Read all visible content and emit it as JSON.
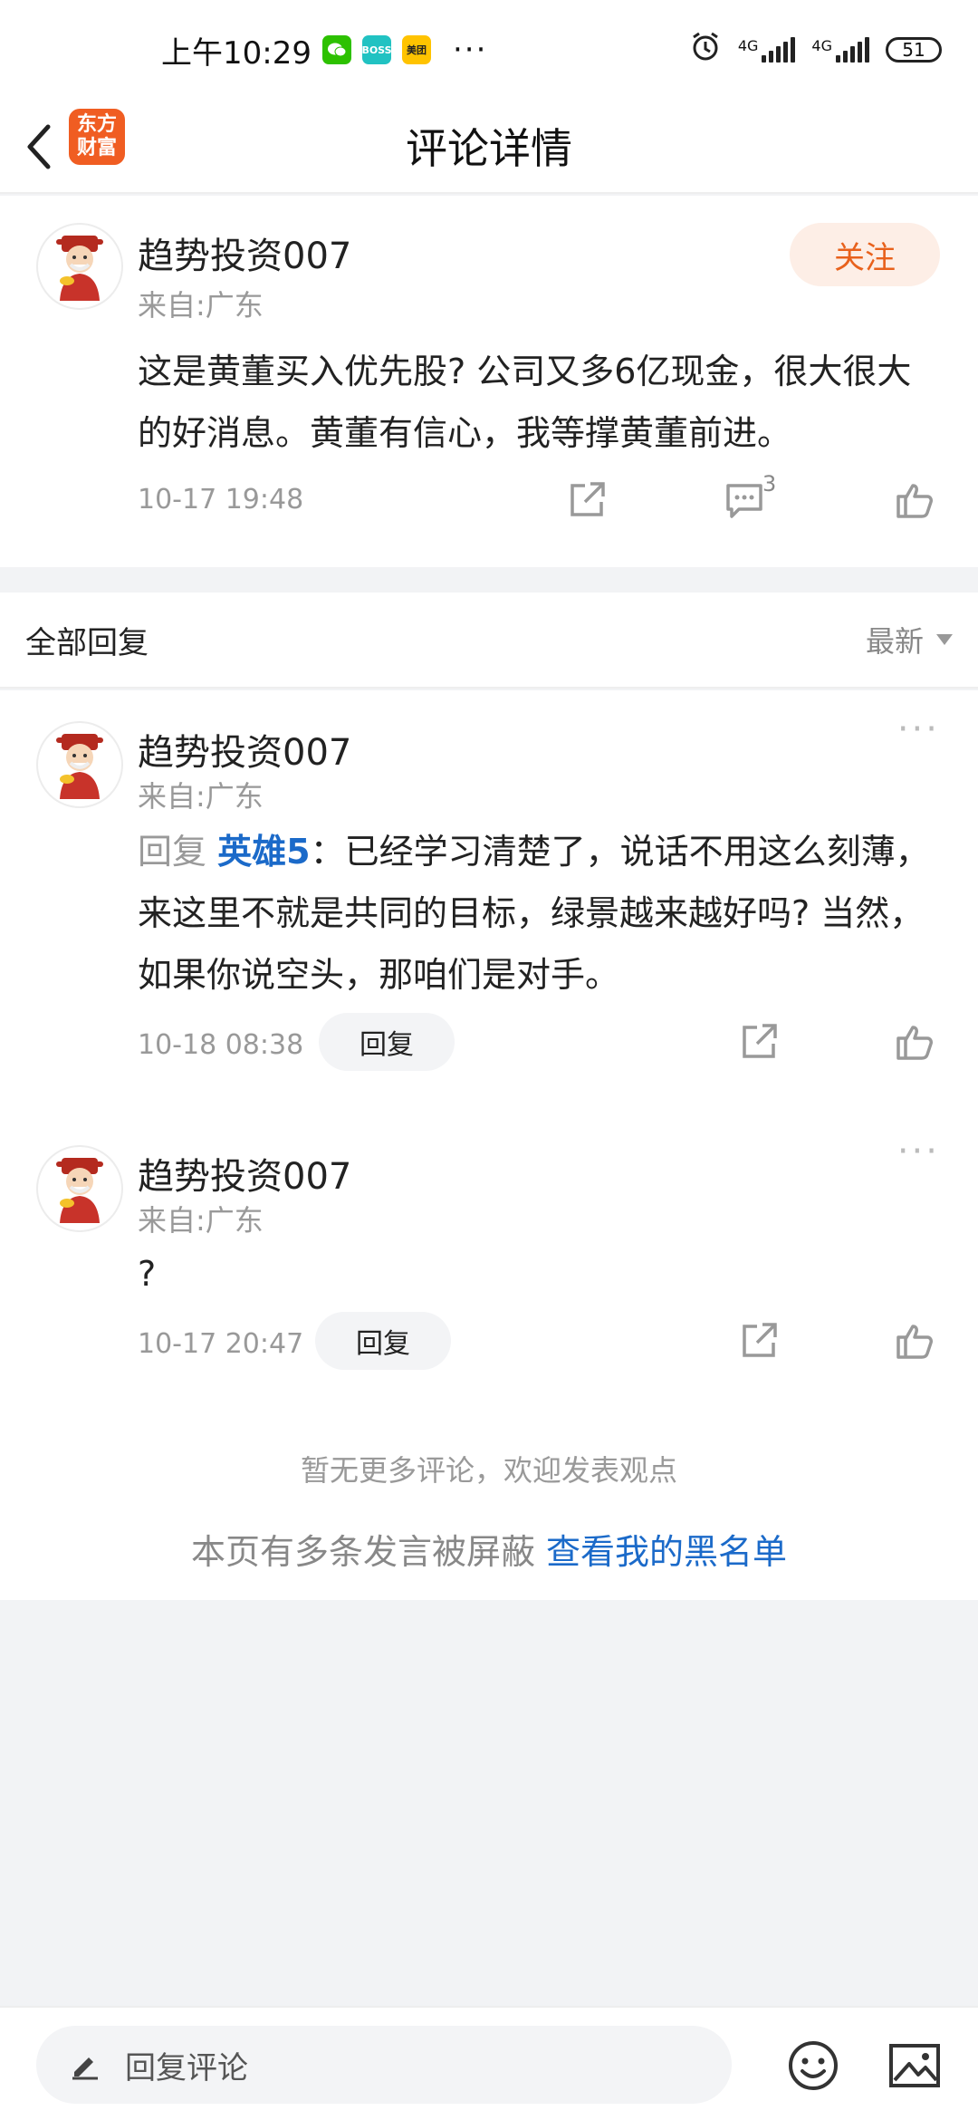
{
  "status_bar": {
    "time": "上午10:29",
    "apps": [
      "wechat",
      "boss-zhipin",
      "meituan"
    ],
    "app_labels": {
      "boss": "BOSS",
      "meituan": "美团"
    },
    "dots": "···",
    "network_1": "4G",
    "network_2": "4G",
    "battery": "51"
  },
  "header": {
    "title": "评论详情",
    "logo_line1": "东方",
    "logo_line2": "财富"
  },
  "main_comment": {
    "username": "趋势投资007",
    "location": "来自:广东",
    "follow_label": "关注",
    "text": "这是黄董买入优先股? 公司又多6亿现金，很大很大的好消息。黄董有信心，我等撑黄董前进。",
    "time": "10-17 19:48",
    "reply_count": "3"
  },
  "replies_section": {
    "title": "全部回复",
    "sort_label": "最新"
  },
  "replies": [
    {
      "username": "趋势投资007",
      "location": "来自:广东",
      "prefix": "回复",
      "mention": "英雄5",
      "text": "：已经学习清楚了，说话不用这么刻薄，来这里不就是共同的目标，绿景越来越好吗? 当然，如果你说空头，那咱们是对手。",
      "time": "10-18 08:38",
      "reply_label": "回复"
    },
    {
      "username": "趋势投资007",
      "location": "来自:广东",
      "text": "?",
      "time": "10-17 20:47",
      "reply_label": "回复"
    }
  ],
  "footer_notes": {
    "no_more": "暂无更多评论，欢迎发表观点",
    "blocked_prefix": "本页有多条发言被屏蔽",
    "blocked_link": "查看我的黑名单"
  },
  "bottom_bar": {
    "input_placeholder": "回复评论"
  },
  "colors": {
    "accent_orange": "#e8611c",
    "link_blue": "#1b6ac9",
    "brand": "#f05d22"
  }
}
